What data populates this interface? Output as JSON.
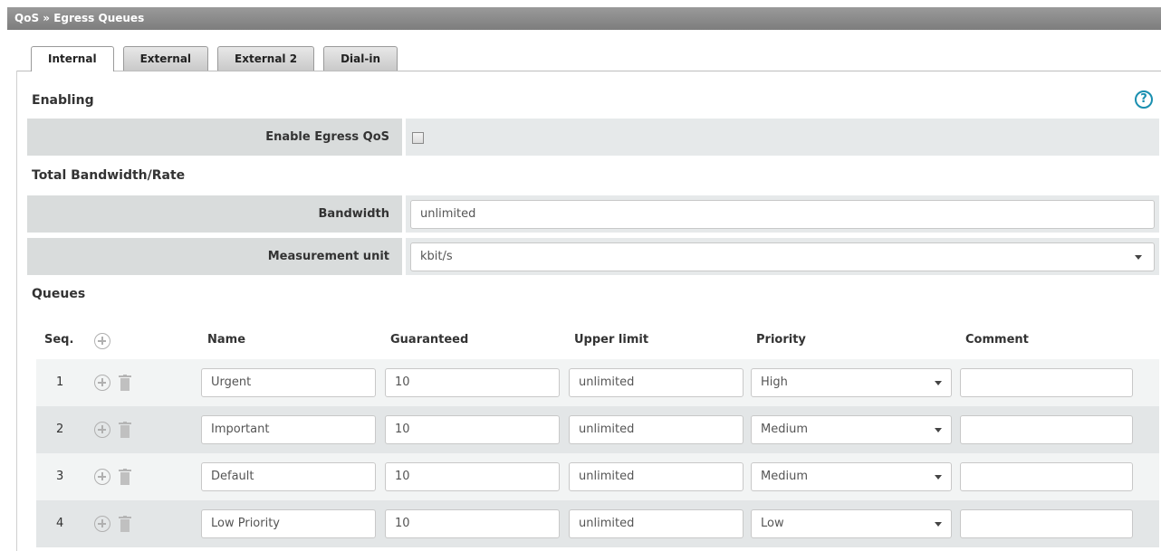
{
  "breadcrumb": "QoS » Egress Queues",
  "tabs": [
    "Internal",
    "External",
    "External 2",
    "Dial-in"
  ],
  "active_tab": "Internal",
  "sections": {
    "enabling": "Enabling",
    "bandwidth": "Total Bandwidth/Rate",
    "queues": "Queues"
  },
  "help_icon": "?",
  "enable_qos": {
    "label": "Enable Egress QoS",
    "checked": false
  },
  "bandwidth": {
    "label": "Bandwidth",
    "value": "unlimited"
  },
  "measurement": {
    "label": "Measurement unit",
    "value": "kbit/s"
  },
  "table": {
    "headers": {
      "seq": "Seq.",
      "name": "Name",
      "guaranteed": "Guaranteed",
      "upper": "Upper limit",
      "priority": "Priority",
      "comment": "Comment"
    },
    "rows": [
      {
        "seq": "1",
        "name": "Urgent",
        "guaranteed": "10",
        "upper": "unlimited",
        "priority": "High",
        "comment": ""
      },
      {
        "seq": "2",
        "name": "Important",
        "guaranteed": "10",
        "upper": "unlimited",
        "priority": "Medium",
        "comment": ""
      },
      {
        "seq": "3",
        "name": "Default",
        "guaranteed": "10",
        "upper": "unlimited",
        "priority": "Medium",
        "comment": ""
      },
      {
        "seq": "4",
        "name": "Low Priority",
        "guaranteed": "10",
        "upper": "unlimited",
        "priority": "Low",
        "comment": ""
      }
    ]
  }
}
